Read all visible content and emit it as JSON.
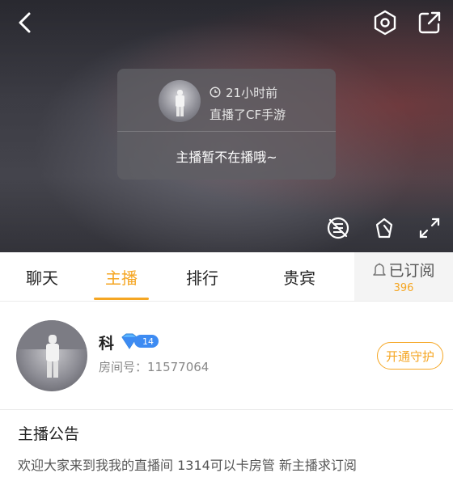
{
  "player": {
    "icons": {
      "back": "chevron-left-icon",
      "settings": "gear-icon",
      "share": "share-icon",
      "danmaku": "danmaku-off-icon",
      "gift": "gift-icon",
      "fullscreen": "fullscreen-icon"
    },
    "status_card": {
      "time_ago": "21小时前",
      "live_text": "直播了CF手游",
      "offline_text": "主播暂不在播哦~"
    }
  },
  "tabs": [
    {
      "label": "聊天"
    },
    {
      "label": "主播",
      "active": true
    },
    {
      "label": "排行"
    },
    {
      "label": "贵宾"
    }
  ],
  "subscribe": {
    "label": "已订阅",
    "count": "396"
  },
  "host": {
    "name": "科",
    "level": "14",
    "room_id_text": "房间号：11577064",
    "guard_button": "开通守护"
  },
  "notice": {
    "title": "主播公告",
    "text": "欢迎大家来到我我的直播间 1314可以卡房管  新主播求订阅"
  },
  "colors": {
    "accent": "#f5a623",
    "badge_blue": "#3d8bf2"
  }
}
